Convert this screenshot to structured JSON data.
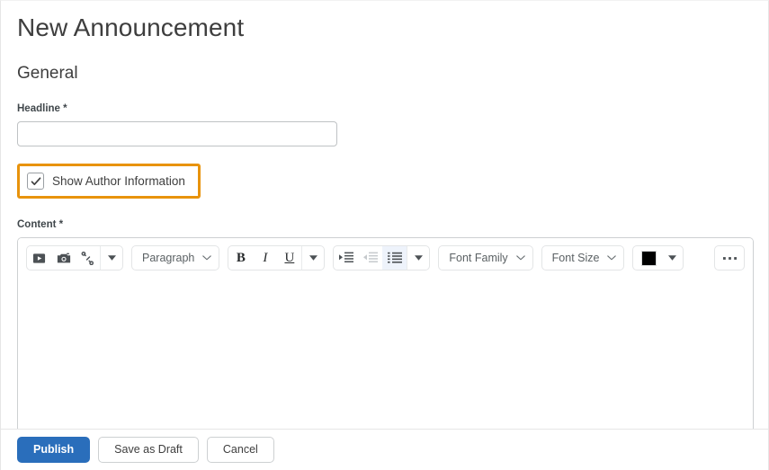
{
  "page": {
    "title": "New Announcement",
    "section_heading": "General"
  },
  "form": {
    "headline": {
      "label": "Headline",
      "required_marker": "*",
      "value": "",
      "placeholder": ""
    },
    "show_author": {
      "label": "Show Author Information",
      "checked": true,
      "highlight_color": "#e8930c"
    },
    "content": {
      "label": "Content",
      "required_marker": "*",
      "body_text": ""
    }
  },
  "editor_toolbar": {
    "groups": [
      {
        "name": "insert",
        "items": [
          {
            "name": "insert-media-icon",
            "type": "icon"
          },
          {
            "name": "insert-image-icon",
            "type": "icon"
          },
          {
            "name": "insert-link-icon",
            "type": "icon"
          },
          {
            "name": "insert-more-caret-icon",
            "type": "caret"
          }
        ]
      },
      {
        "name": "block-format",
        "items": [
          {
            "name": "paragraph-format-select",
            "type": "select",
            "label": "Paragraph"
          }
        ]
      },
      {
        "name": "text-style",
        "items": [
          {
            "name": "bold-button",
            "type": "text",
            "label": "B"
          },
          {
            "name": "italic-button",
            "type": "text",
            "label": "I"
          },
          {
            "name": "underline-button",
            "type": "text",
            "label": "U"
          },
          {
            "name": "text-style-more-caret-icon",
            "type": "caret"
          }
        ]
      },
      {
        "name": "lists-indent",
        "items": [
          {
            "name": "indent-increase-icon",
            "type": "icon"
          },
          {
            "name": "indent-decrease-icon",
            "type": "icon",
            "disabled": true
          },
          {
            "name": "bulleted-list-icon",
            "type": "icon",
            "active": true
          },
          {
            "name": "lists-more-caret-icon",
            "type": "caret"
          }
        ]
      },
      {
        "name": "font-family",
        "items": [
          {
            "name": "font-family-select",
            "type": "select",
            "label": "Font Family"
          }
        ]
      },
      {
        "name": "font-size",
        "items": [
          {
            "name": "font-size-select",
            "type": "select",
            "label": "Font Size"
          }
        ]
      },
      {
        "name": "text-color",
        "items": [
          {
            "name": "text-color-swatch",
            "type": "swatch",
            "color": "#000000"
          },
          {
            "name": "text-color-caret-icon",
            "type": "caret"
          }
        ]
      },
      {
        "name": "overflow",
        "items": [
          {
            "name": "toolbar-overflow-icon",
            "type": "ellipsis",
            "label": "..."
          }
        ]
      }
    ]
  },
  "editor_statusbar": {
    "icons": [
      {
        "name": "spellcheck-icon"
      },
      {
        "name": "accessibility-check-icon"
      },
      {
        "name": "html-source-icon"
      },
      {
        "name": "word-count-icon"
      },
      {
        "name": "fullscreen-icon"
      },
      {
        "name": "resize-handle-icon"
      }
    ]
  },
  "footer": {
    "buttons": [
      {
        "name": "publish-button",
        "label": "Publish",
        "style": "primary"
      },
      {
        "name": "save-as-draft-button",
        "label": "Save as Draft",
        "style": "secondary"
      },
      {
        "name": "cancel-button",
        "label": "Cancel",
        "style": "secondary"
      }
    ],
    "primary_color": "#2a6ebb"
  }
}
